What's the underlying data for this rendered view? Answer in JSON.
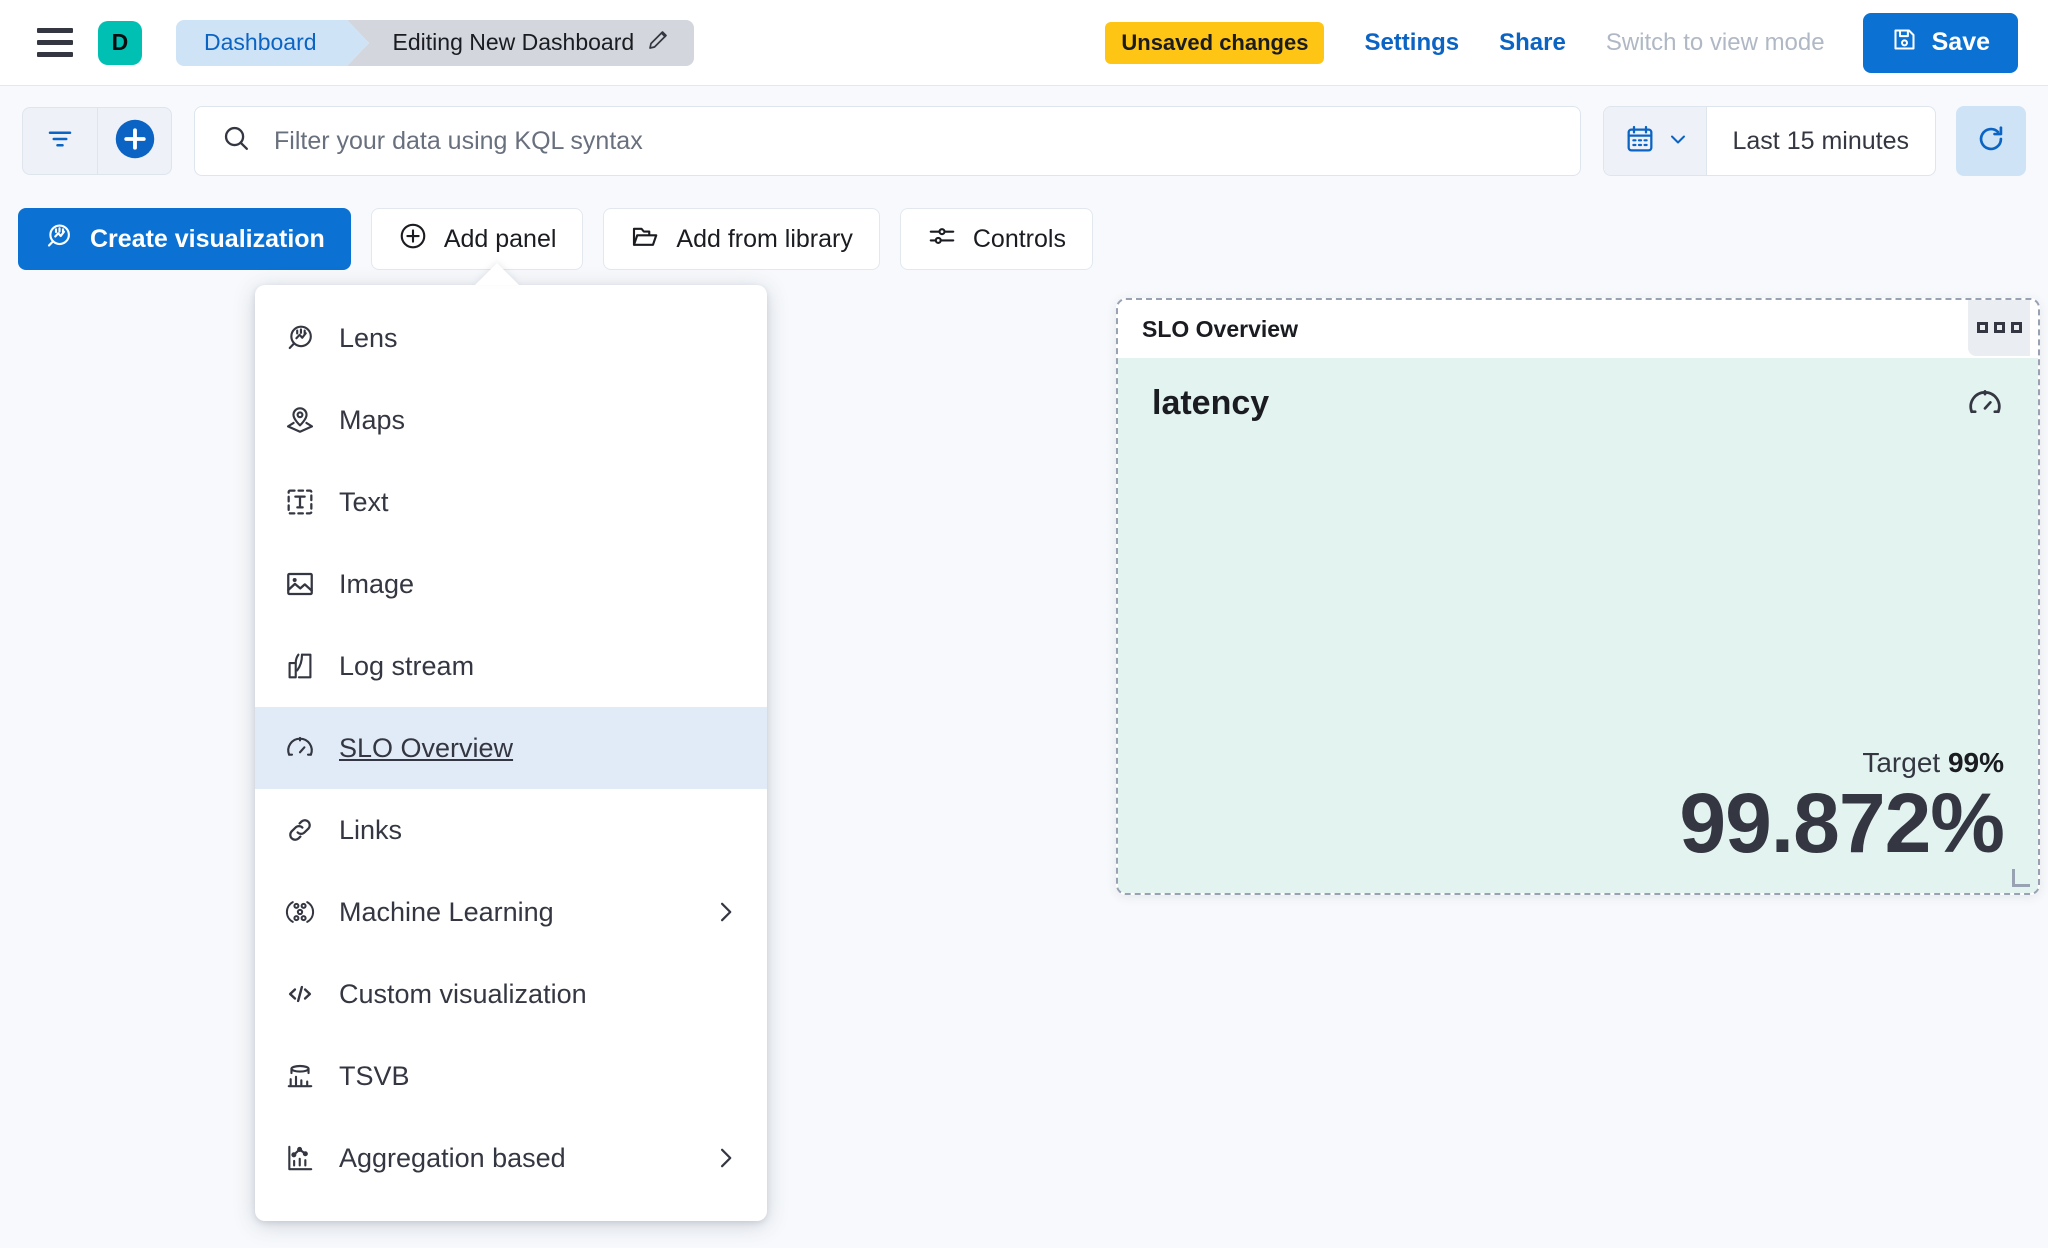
{
  "chrome": {
    "menu_icon": "hamburger-icon",
    "avatar_letter": "D",
    "breadcrumb_root": "Dashboard",
    "breadcrumb_current": "Editing New Dashboard",
    "edit_icon": "pencil-icon",
    "unsaved_badge": "Unsaved changes",
    "settings_link": "Settings",
    "share_link": "Share",
    "view_mode_link": "Switch to view mode",
    "save_label": "Save",
    "save_icon": "save-disk-icon",
    "accent_blue": "#0b72d4",
    "badge_yellow": "#fec514",
    "avatar_teal": "#00bfb3"
  },
  "query": {
    "filter_icon": "filter-icon",
    "add_filter_icon": "plus-circle-icon",
    "search_icon": "search-icon",
    "search_value": "",
    "search_placeholder": "Filter your data using KQL syntax",
    "calendar_icon": "calendar-icon",
    "calendar_chevron": "chevron-down-icon",
    "date_range": "Last 15 minutes",
    "refresh_icon": "refresh-icon"
  },
  "toolbar": {
    "create_visualization": "Create visualization",
    "create_visualization_icon": "lens-icon",
    "add_panel": "Add panel",
    "add_panel_icon": "plus-in-circle-icon",
    "add_from_library": "Add from library",
    "add_from_library_icon": "folder-icon",
    "controls": "Controls",
    "controls_icon": "sliders-icon"
  },
  "add_panel_menu": {
    "items": [
      {
        "label": "Lens",
        "icon": "lens-icon",
        "submenu": false,
        "active": false
      },
      {
        "label": "Maps",
        "icon": "map-pin-icon",
        "submenu": false,
        "active": false
      },
      {
        "label": "Text",
        "icon": "text-box-icon",
        "submenu": false,
        "active": false
      },
      {
        "label": "Image",
        "icon": "image-icon",
        "submenu": false,
        "active": false
      },
      {
        "label": "Log stream",
        "icon": "log-stream-icon",
        "submenu": false,
        "active": false
      },
      {
        "label": "SLO Overview",
        "icon": "gauge-icon",
        "submenu": false,
        "active": true
      },
      {
        "label": "Links",
        "icon": "link-icon",
        "submenu": false,
        "active": false
      },
      {
        "label": "Machine Learning",
        "icon": "ml-nodes-icon",
        "submenu": true,
        "active": false
      },
      {
        "label": "Custom visualization",
        "icon": "code-icon",
        "submenu": false,
        "active": false
      },
      {
        "label": "TSVB",
        "icon": "tsvb-icon",
        "submenu": false,
        "active": false
      },
      {
        "label": "Aggregation based",
        "icon": "agg-chart-icon",
        "submenu": true,
        "active": false
      }
    ]
  },
  "slo_panel": {
    "header_title": "SLO Overview",
    "context_menu_icon": "three-dots-icon",
    "slo_name": "latency",
    "gauge_icon": "gauge-icon",
    "target_label": "Target",
    "target_value": "99%",
    "sli_value": "99.872%",
    "body_background": "#e3f3f0"
  }
}
